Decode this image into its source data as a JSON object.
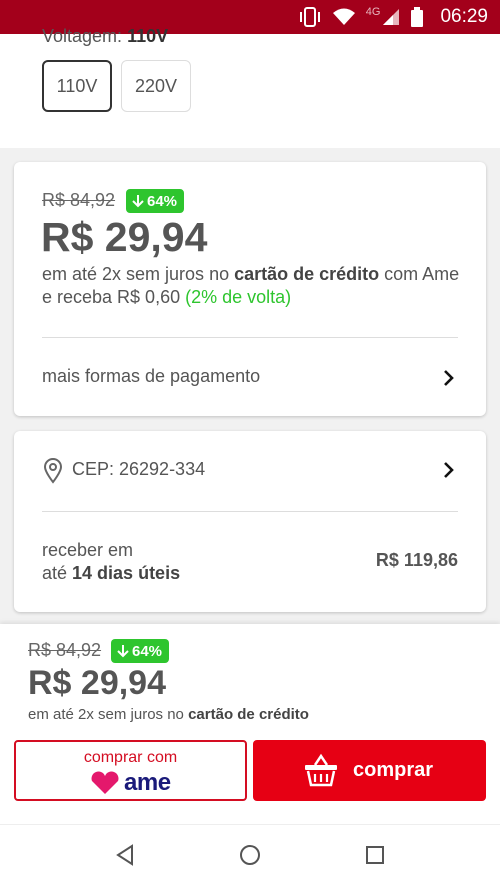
{
  "status": {
    "time": "06:29",
    "network": "4G"
  },
  "voltage": {
    "label": "Voltagem:",
    "value": "110V",
    "options": [
      "110V",
      "220V"
    ]
  },
  "price_card": {
    "old_price": "R$ 84,92",
    "discount": "64%",
    "price": "R$ 29,94",
    "installment_pre": "em até 2x sem juros no ",
    "installment_bold": "cartão de crédito",
    "installment_post": " com Ame e receba R$ 0,60 ",
    "cashback": "(2% de volta)",
    "more_payment": "mais formas de pagamento"
  },
  "shipping": {
    "cep": "CEP: 26292-334",
    "receive_line1": "receber em",
    "receive_pre": "até ",
    "receive_bold": "14 dias úteis",
    "shipping_price": "R$ 119,86"
  },
  "bottom": {
    "old_price": "R$ 84,92",
    "discount": "64%",
    "price": "R$ 29,94",
    "installment_pre": "em até 2x sem juros no ",
    "installment_bold": "cartão de crédito",
    "ame_button_label": "comprar com",
    "ame_logo": "ame",
    "buy_button_label": "comprar"
  },
  "colors": {
    "status_bar": "#a3001b",
    "accent_red": "#e60014",
    "discount_green": "#2ec52e",
    "ame_navy": "#1a1a7a"
  },
  "icons": [
    "vibrate-icon",
    "wifi-icon",
    "signal-icon",
    "battery-icon",
    "arrow-down-icon",
    "chevron-right-icon",
    "location-pin-icon",
    "heart-icon",
    "basket-icon",
    "nav-back-icon",
    "nav-home-icon",
    "nav-recents-icon"
  ]
}
